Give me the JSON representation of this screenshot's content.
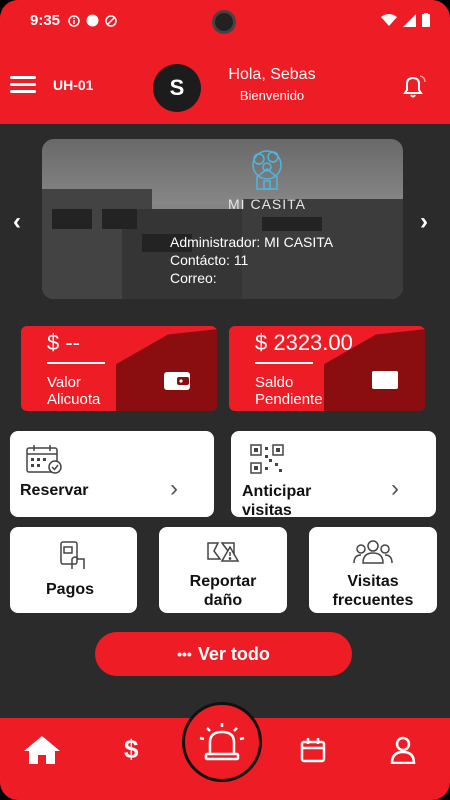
{
  "status_bar": {
    "time": "9:35"
  },
  "header": {
    "unit_code": "UH-01",
    "avatar_initial": "S",
    "greeting": "Hola, Sebas",
    "welcome": "Bienvenido"
  },
  "banner": {
    "logo_text": "MI CASITA",
    "admin_line": "Administrador: MI CASITA",
    "contact_line": "Contácto: 11",
    "email_line": "Correo:"
  },
  "cards": {
    "alicuota": {
      "amount": "$ --",
      "label_line1": "Valor",
      "label_line2": "Alicuota"
    },
    "saldo": {
      "amount": "$ 2323.00",
      "label_line1": "Saldo",
      "label_line2": "Pendiente"
    }
  },
  "actions": {
    "reservar": "Reservar",
    "anticipar_line1": "Anticipar",
    "anticipar_line2": "visitas",
    "pagos": "Pagos",
    "reportar_line1": "Reportar",
    "reportar_line2": "daño",
    "visitas_line1": "Visitas",
    "visitas_line2": "frecuentes"
  },
  "ver_todo": {
    "dots": "•••",
    "label": "Ver todo"
  },
  "colors": {
    "accent": "#ee1c25",
    "dark_accent": "#8a0d10",
    "background": "#2b2b2b"
  },
  "icons": [
    "menu-icon",
    "bell-icon",
    "wallet-icon",
    "card-icon",
    "calendar-icon",
    "qr-icon",
    "payment-icon",
    "damage-icon",
    "group-icon",
    "home-icon",
    "dollar-icon",
    "alarm-icon",
    "user-icon"
  ]
}
